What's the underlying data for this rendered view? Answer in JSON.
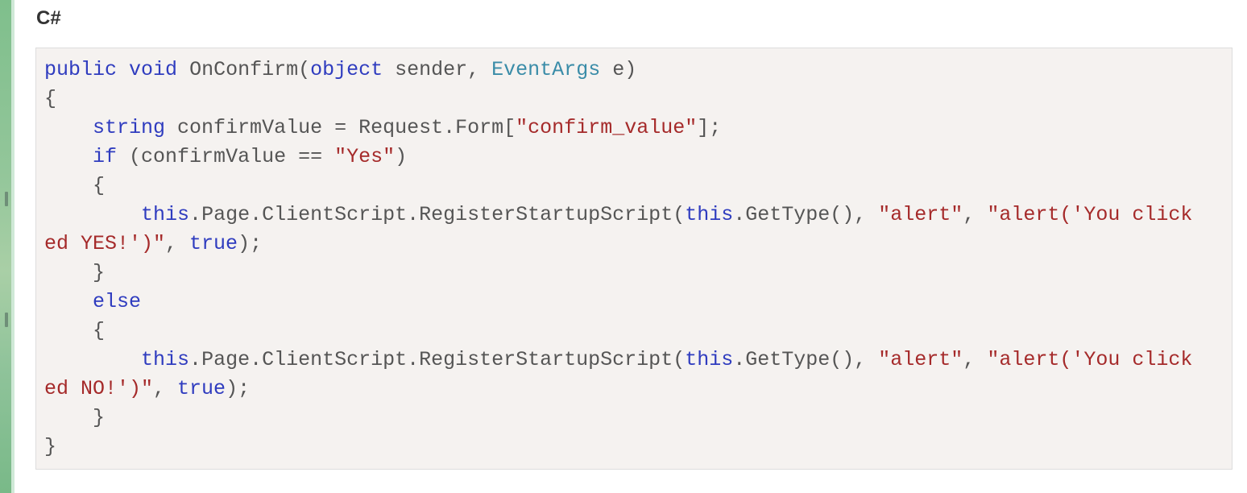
{
  "section": {
    "title": "C#"
  },
  "code": {
    "language": "C#",
    "lines": [
      "public void OnConfirm(object sender, EventArgs e)",
      "{",
      "    string confirmValue = Request.Form[\"confirm_value\"];",
      "    if (confirmValue == \"Yes\")",
      "    {",
      "        this.Page.ClientScript.RegisterStartupScript(this.GetType(), \"alert\", \"alert('You click",
      "ed YES!')\", true);",
      "    }",
      "    else",
      "    {",
      "        this.Page.ClientScript.RegisterStartupScript(this.GetType(), \"alert\", \"alert('You click",
      "ed NO!')\", true);",
      "    }",
      "}"
    ]
  },
  "colors": {
    "keyword": "#2f3cbf",
    "type": "#3a8ca8",
    "string": "#a52a2a",
    "plain": "#555555",
    "code_background": "#f5f2f0"
  }
}
